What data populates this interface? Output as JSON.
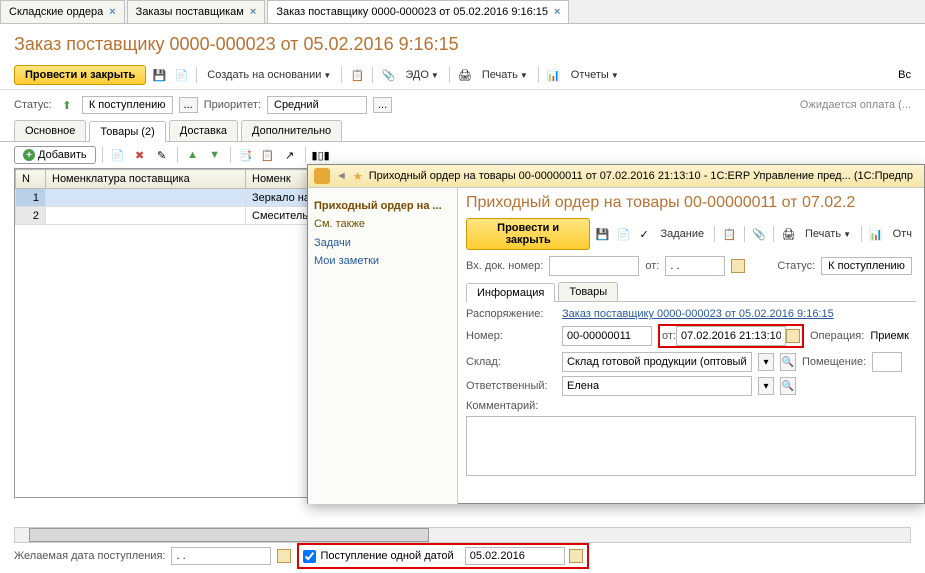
{
  "tabs": [
    {
      "label": "Складские ордера"
    },
    {
      "label": "Заказы поставщикам"
    },
    {
      "label": "Заказ поставщику 0000-000023 от 05.02.2016 9:16:15"
    }
  ],
  "header": {
    "title": "Заказ поставщику 0000-000023 от 05.02.2016 9:16:15"
  },
  "toolbar": {
    "post_close": "Провести и закрыть",
    "create_basis": "Создать на основании",
    "edo": "ЭДО",
    "print": "Печать",
    "reports": "Отчеты",
    "all": "Вс"
  },
  "status": {
    "label": "Статус:",
    "value": "К поступлению",
    "priority_label": "Приоритет:",
    "priority_value": "Средний",
    "right": "Ожидается оплата (..."
  },
  "subtabs": [
    "Основное",
    "Товары (2)",
    "Доставка",
    "Дополнительно"
  ],
  "actions": {
    "add": "Добавить"
  },
  "table": {
    "headers": [
      "N",
      "Номенклатура поставщика",
      "Номенк"
    ],
    "rows": [
      {
        "n": "1",
        "supplier": "",
        "nom": "Зеркало на"
      },
      {
        "n": "2",
        "supplier": "",
        "nom": "Смеситель"
      }
    ]
  },
  "footer": {
    "desired_label": "Желаемая дата поступления:",
    "desired_value": ". .",
    "single_date_label": "Поступление одной датой",
    "single_date_value": "05.02.2016"
  },
  "modal": {
    "title": "Приходный ордер на товары 00-00000011 от 07.02.2016 21:13:10 - 1C:ERP Управление пред... (1C:Предпр",
    "side": {
      "head": "Приходный ордер на ...",
      "see_also": "См. также",
      "tasks": "Задачи",
      "notes": "Мои заметки"
    },
    "main": {
      "title": "Приходный ордер на товары 00-00000011 от 07.02.2",
      "post_close": "Провести и закрыть",
      "task_btn": "Задание",
      "print": "Печать",
      "reports": "Отч",
      "incoming_label": "Вх. док. номер:",
      "from_label": "от:",
      "from_value": ". .",
      "status_label": "Статус:",
      "status_value": "К поступлению",
      "inner_tabs": [
        "Информация",
        "Товары"
      ],
      "order_label": "Распоряжение:",
      "order_link": "Заказ поставщику 0000-000023 от 05.02.2016 9:16:15",
      "number_label": "Номер:",
      "number_value": "00-00000011",
      "date_label": "от:",
      "date_value": "07.02.2016 21:13:10",
      "operation_label": "Операция:",
      "operation_value": "Приемк",
      "warehouse_label": "Склад:",
      "warehouse_value": "Склад готовой продукции (оптовый)",
      "room_label": "Помещение:",
      "responsible_label": "Ответственный:",
      "responsible_value": "Елена",
      "comment_label": "Комментарий:"
    }
  }
}
